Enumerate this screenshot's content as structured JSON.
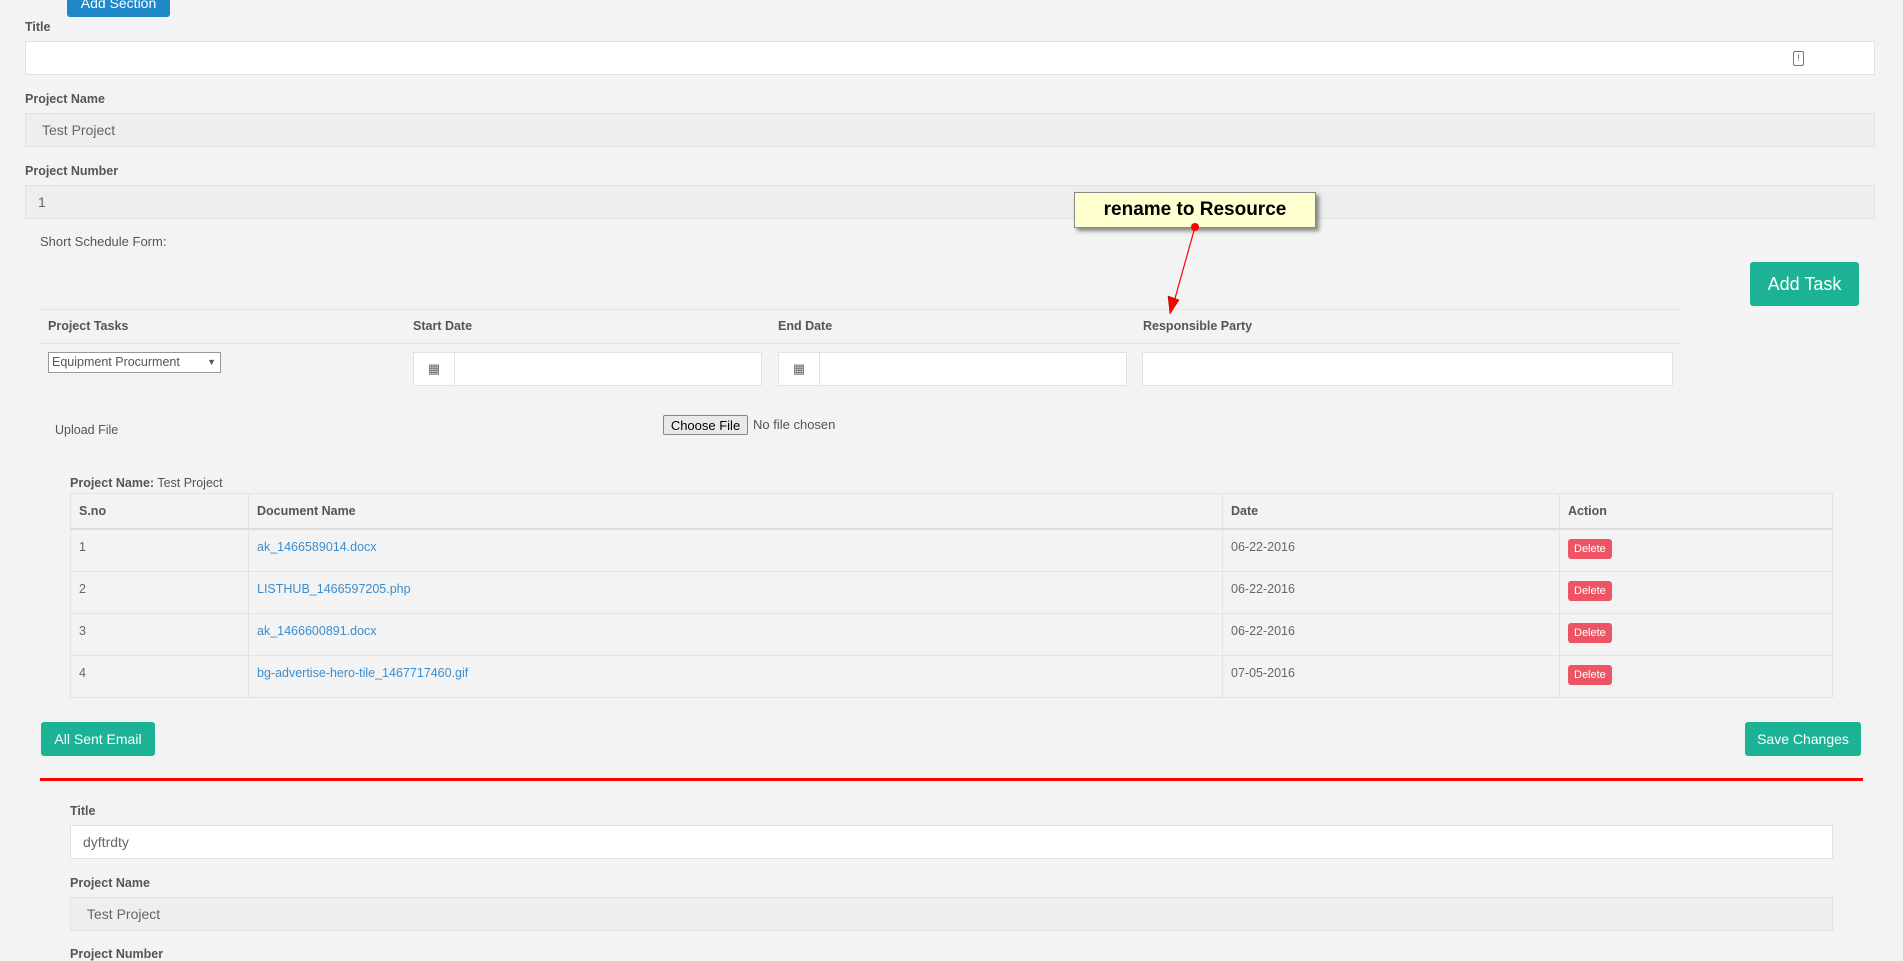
{
  "top": {
    "add_section": "Add Section"
  },
  "form1": {
    "title_label": "Title",
    "title_value": "",
    "project_name_label": "Project Name",
    "project_name_value": "Test Project",
    "project_number_label": "Project Number",
    "project_number_value": "1",
    "short_schedule_label": "Short Schedule Form:",
    "add_task": "Add Task",
    "task_headers": [
      "Project Tasks",
      "Start Date",
      "End Date",
      "Responsible Party"
    ],
    "task_select_value": "Equipment Procurment",
    "upload_label": "Upload File",
    "choose_file": "Choose File",
    "no_file": "No file chosen"
  },
  "annotation": {
    "text": "rename to Resource",
    "color": "#ff0000"
  },
  "documents": {
    "project_label": "Project Name:",
    "project_value": "Test Project",
    "headers": [
      "S.no",
      "Document Name",
      "Date",
      "Action"
    ],
    "rows": [
      {
        "sno": "1",
        "name": "ak_1466589014.docx",
        "date": "06-22-2016",
        "action": "Delete"
      },
      {
        "sno": "2",
        "name": "LISTHUB_1466597205.php",
        "date": "06-22-2016",
        "action": "Delete"
      },
      {
        "sno": "3",
        "name": "ak_1466600891.docx",
        "date": "06-22-2016",
        "action": "Delete"
      },
      {
        "sno": "4",
        "name": "bg-advertise-hero-tile_1467717460.gif",
        "date": "07-05-2016",
        "action": "Delete"
      }
    ]
  },
  "footer": {
    "all_sent_email": "All Sent Email",
    "save_changes": "Save Changes"
  },
  "form2": {
    "title_label": "Title",
    "title_value": "dyftrdty",
    "project_name_label": "Project Name",
    "project_name_value": "Test Project",
    "project_number_label": "Project Number"
  },
  "colors": {
    "primary": "#1e88c8",
    "success": "#1bb394",
    "danger": "#ed5565",
    "divider": "#ff0000"
  }
}
